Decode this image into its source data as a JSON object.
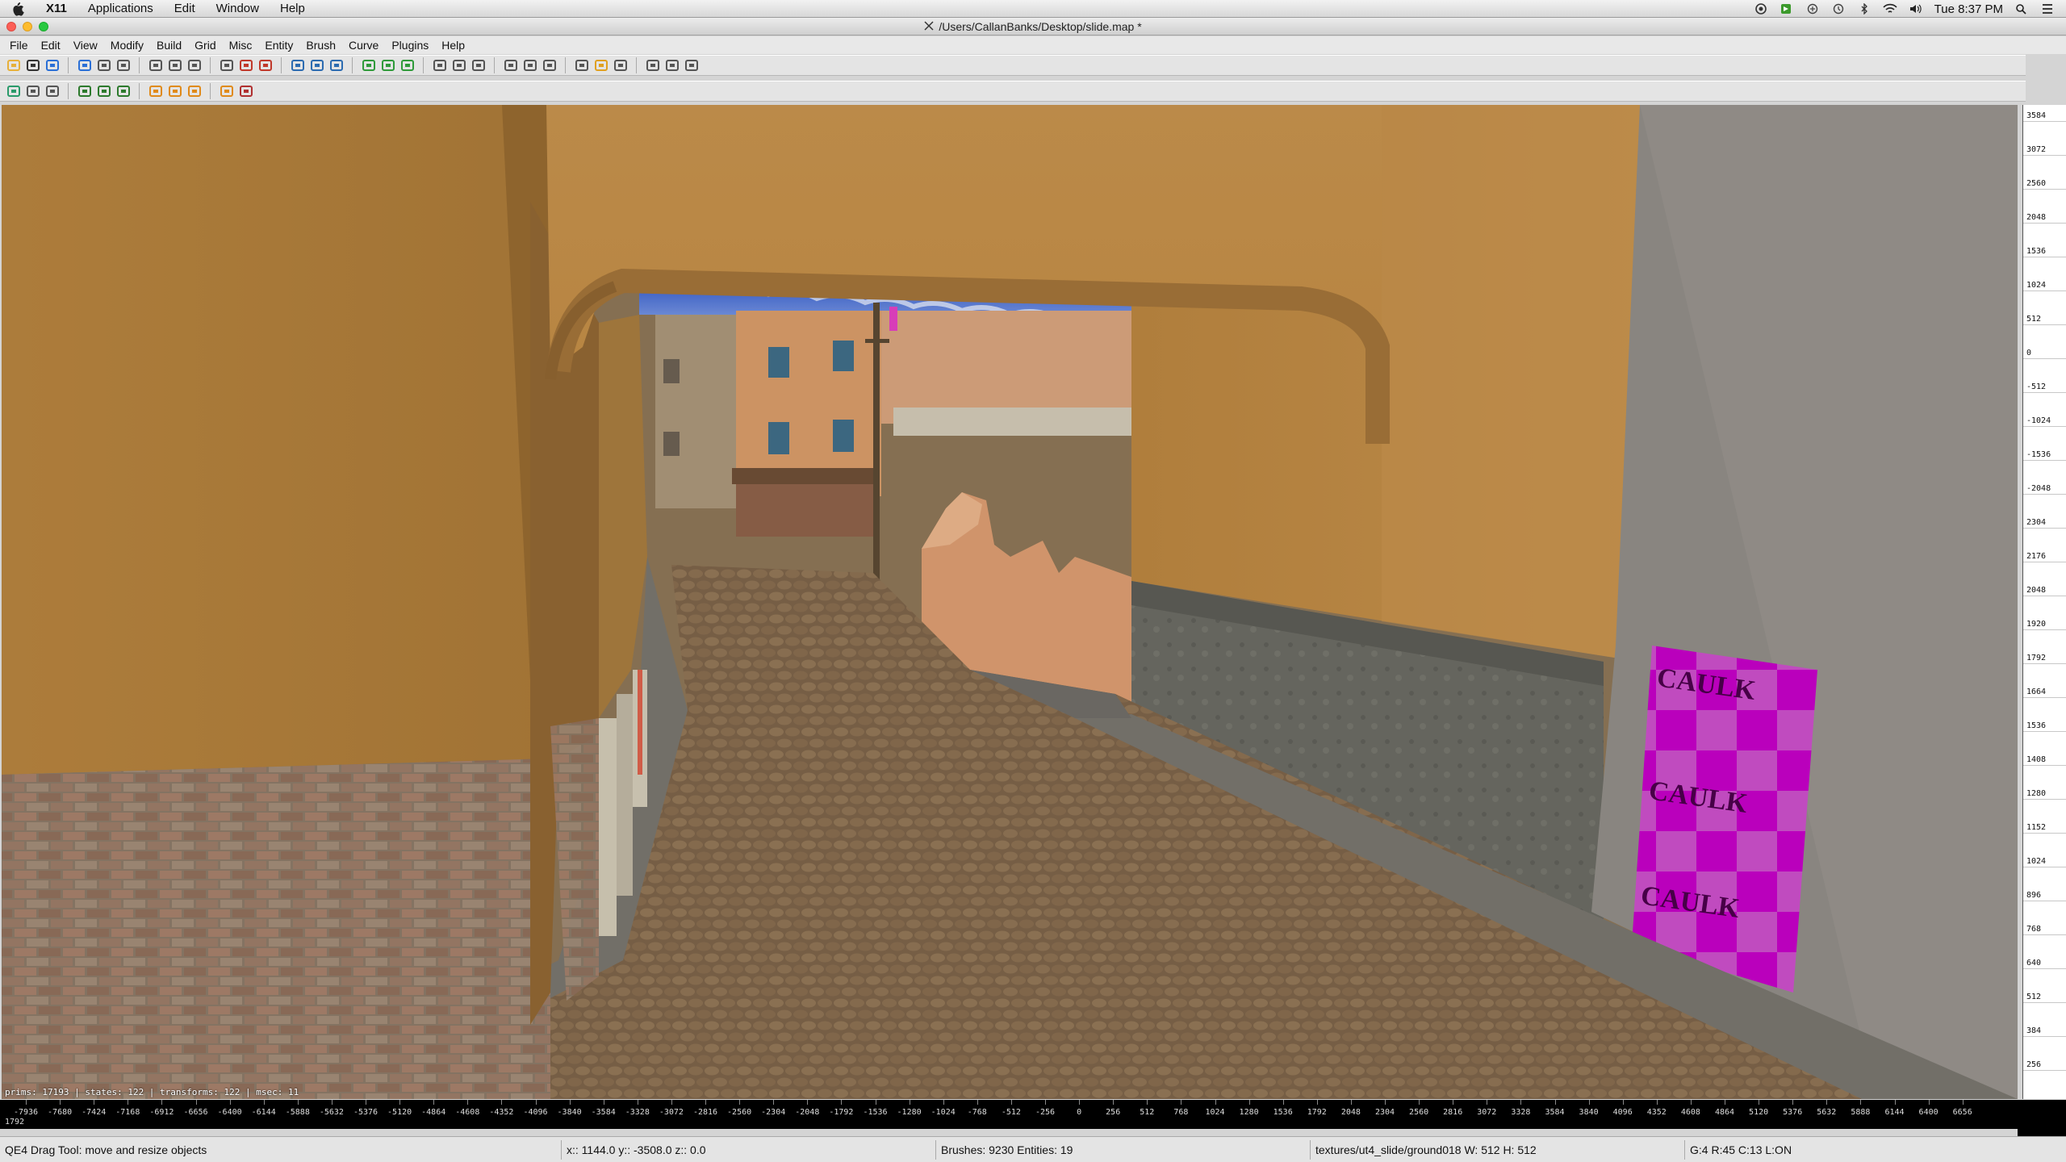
{
  "macmenu": {
    "app": "X11",
    "items": [
      "Applications",
      "Edit",
      "Window",
      "Help"
    ],
    "clock": "Tue 8:37 PM"
  },
  "window": {
    "title": "/Users/CallanBanks/Desktop/slide.map *"
  },
  "menubar": [
    "File",
    "Edit",
    "View",
    "Modify",
    "Build",
    "Grid",
    "Misc",
    "Entity",
    "Brush",
    "Curve",
    "Plugins",
    "Help"
  ],
  "toolbar1": [
    "open-icon",
    "save-icon",
    "undo-icon",
    "redo-icon",
    "flip-x-icon",
    "flip-y-icon",
    "flip-z-icon",
    "rotate-x-icon",
    "rotate-y-icon",
    "rotate-z-icon",
    "csg-subtract-icon",
    "csg-merge-icon",
    "view-xy-icon",
    "view-yz-icon",
    "view-xz-icon",
    "brush-make-hollow-icon",
    "brush-make-room-icon",
    "brush-cube-icon",
    "clipper-icon",
    "drag-tool-icon",
    "move-tool-icon",
    "rotate-tool-icon",
    "scale-tool-icon",
    "texture-lock-icon",
    "show-patches-icon",
    "camera-icon",
    "texture-window-icon",
    "entity-window-icon",
    "console-icon",
    "filter-icon"
  ],
  "toolbar2": [
    "refresh-icon",
    "shaders-icon",
    "texture-browser-icon",
    "plugin-a-icon",
    "plugin-b-icon",
    "plugin-c-icon",
    "bobtoolz-a-icon",
    "bobtoolz-b-icon",
    "bobtoolz-c-icon",
    "bobtoolz-d-icon",
    "close-plugin-icon"
  ],
  "viewport": {
    "stats": "prims: 17193 | states: 122 | transforms: 122 | msec: 11",
    "caulk_text": "CAULK"
  },
  "grid2d": {
    "labels": [
      "3584",
      "3072",
      "2560",
      "2048",
      "1536",
      "1024",
      "512",
      "0",
      "-512",
      "-1024",
      "-1536",
      "-2048",
      "2304",
      "2176",
      "2048",
      "1920",
      "1792",
      "1664",
      "1536",
      "1408",
      "1280",
      "1152",
      "1024",
      "896",
      "768",
      "640",
      "512",
      "384",
      "256"
    ]
  },
  "ruler": {
    "ticks": [
      "-7936",
      "-7680",
      "-7424",
      "-7168",
      "-6912",
      "-6656",
      "-6400",
      "-6144",
      "-5888",
      "-5632",
      "-5376",
      "-5120",
      "-4864",
      "-4608",
      "-4352",
      "-4096",
      "-3840",
      "-3584",
      "-3328",
      "-3072",
      "-2816",
      "-2560",
      "-2304",
      "-2048",
      "-1792",
      "-1536",
      "-1280",
      "-1024",
      "-768",
      "-512",
      "-256",
      "0",
      "256",
      "512",
      "768",
      "1024",
      "1280",
      "1536",
      "1792",
      "2048",
      "2304",
      "2560",
      "2816",
      "3072",
      "3328",
      "3584",
      "3840",
      "4096",
      "4352",
      "4608",
      "4864",
      "5120",
      "5376",
      "5632",
      "5888",
      "6144",
      "6400",
      "6656"
    ],
    "corner": "1792"
  },
  "status": {
    "tool": "QE4 Drag Tool: move and resize objects",
    "coords": "x:: 1144.0  y:: -3508.0  z::    0.0",
    "counts": "Brushes: 9230 Entities: 19",
    "texture": "textures/ut4_slide/ground018 W: 512 H: 512",
    "grid": "G:4  R:45  C:13  L:ON"
  }
}
